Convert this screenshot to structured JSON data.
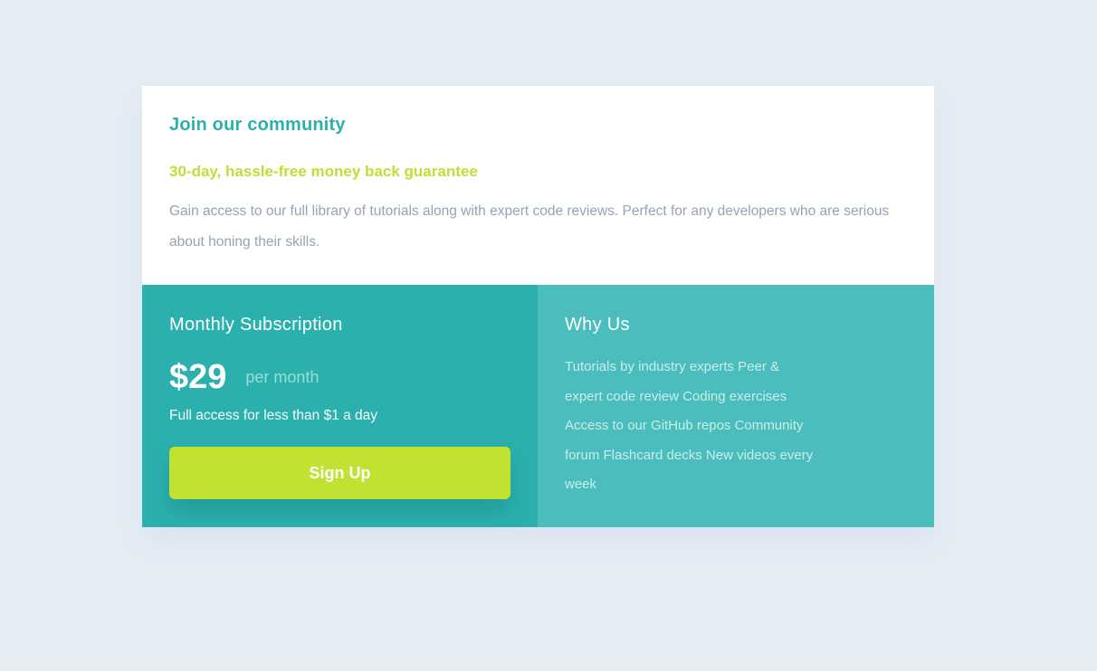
{
  "header": {
    "title": "Join our community",
    "guarantee": "30-day, hassle-free money back guarantee",
    "description": "Gain access to our full library of tutorials along with expert code reviews. Perfect for any developers who are serious about honing their skills."
  },
  "subscription": {
    "title": "Monthly Subscription",
    "price": "$29",
    "period": "per month",
    "note": "Full access for less than $1 a day",
    "button_label": "Sign Up"
  },
  "why_us": {
    "title": "Why Us",
    "text": "Tutorials by industry experts Peer & expert code review Coding exercises Access to our GitHub repos Community forum Flashcard decks New videos every week"
  },
  "colors": {
    "page_background": "#e5ecf4",
    "accent_teal": "#2bb0ae",
    "light_teal": "#4bbdbd",
    "lime": "#c0df34",
    "body_text": "#97a2b7"
  }
}
